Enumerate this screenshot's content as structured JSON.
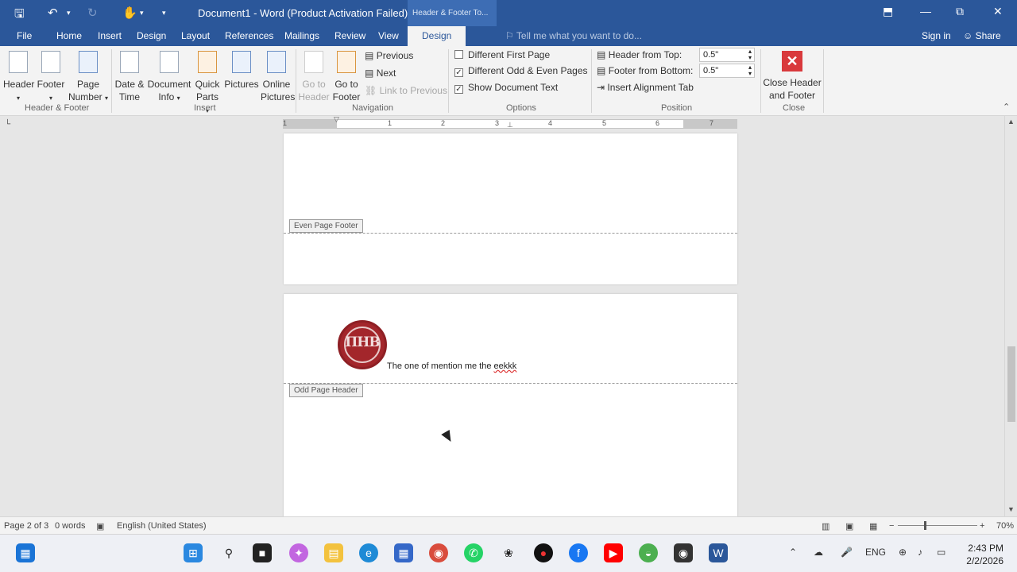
{
  "titlebar": {
    "doc_title": "Document1 - Word (Product Activation Failed)",
    "context_tab": "Header & Footer To...",
    "icons": [
      "save-icon",
      "undo-icon",
      "redo-icon",
      "touch-mode-icon",
      "customize-qat-icon"
    ]
  },
  "tabs": [
    "File",
    "Home",
    "Insert",
    "Design",
    "Layout",
    "References",
    "Mailings",
    "Review",
    "View",
    "Design"
  ],
  "active_tab": "Design",
  "tell_me": "Tell me what you want to do...",
  "account": {
    "signin": "Sign in",
    "share": "Share"
  },
  "ribbon": {
    "groups": {
      "header_footer": "Header & Footer",
      "insert": "Insert",
      "navigation": "Navigation",
      "options": "Options",
      "position": "Position",
      "close": "Close"
    },
    "header_footer": {
      "header": "Header",
      "footer": "Footer",
      "page": "Page",
      "number": "Number"
    },
    "insert": {
      "date": "Date &",
      "time": "Time",
      "document": "Document",
      "info": "Info",
      "quick": "Quick",
      "parts": "Parts",
      "pictures": "Pictures",
      "online": "Online",
      "online_pictures": "Pictures"
    },
    "navigation": {
      "goto": "Go to",
      "header": "Header",
      "goto2": "Go to",
      "footer": "Footer",
      "previous": "Previous",
      "next": "Next",
      "link_previous": "Link to Previous"
    },
    "options": {
      "diff_first": "Different First Page",
      "diff_first_checked": false,
      "diff_odd_even": "Different Odd & Even Pages",
      "diff_odd_even_checked": true,
      "show_doc_text": "Show Document Text",
      "show_doc_text_checked": true
    },
    "position": {
      "header_from_top_label": "Header from Top:",
      "header_from_top_value": "0.5\"",
      "footer_from_bottom_label": "Footer from Bottom:",
      "footer_from_bottom_value": "0.5\"",
      "insert_alignment_tab": "Insert Alignment Tab"
    },
    "close": {
      "line1": "Close Header",
      "line2": "and Footer"
    }
  },
  "ruler": {
    "numbers": [
      "1",
      "1",
      "2",
      "3",
      "4",
      "5",
      "6",
      "7"
    ]
  },
  "document": {
    "even_footer_tag": "Even Page Footer",
    "odd_header_tag": "Odd Page Header",
    "header_text_prefix": "The one of mention me the ",
    "header_text_misspelled": "eekkk",
    "logo_letters": "ΠΗΒ"
  },
  "statusbar": {
    "page": "Page 2 of 3",
    "words": "0 words",
    "language": "English (United States)",
    "zoom": "70%",
    "zoom_minus": "−",
    "zoom_plus": "+"
  },
  "taskbar": {
    "apps": [
      "widgets-icon",
      "windows-start-icon",
      "search-icon",
      "task-view-icon",
      "copilot-icon",
      "file-explorer-icon",
      "edge-icon",
      "store-icon",
      "chrome-icon",
      "whatsapp-icon",
      "chatgpt-icon",
      "record-icon",
      "facebook-icon",
      "youtube-icon",
      "green-app-icon",
      "camera-app-icon",
      "word-icon"
    ],
    "lang": "ENG",
    "time": "2:43 PM",
    "date": "2/2/2026"
  }
}
